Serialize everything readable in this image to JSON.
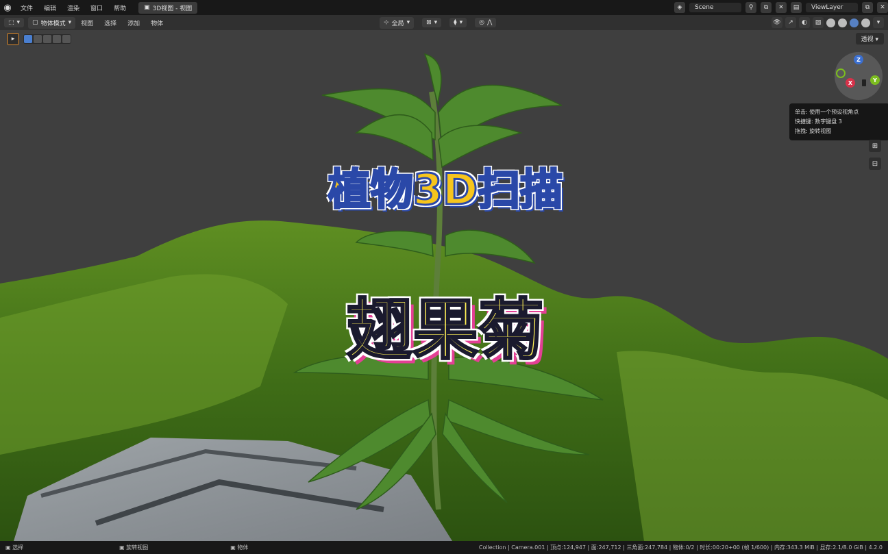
{
  "menubar": {
    "items": [
      "文件",
      "编辑",
      "渲染",
      "窗口",
      "帮助"
    ],
    "workspace_tab": "3D视图 - 视图",
    "scene_label": "Scene",
    "viewlayer_label": "ViewLayer"
  },
  "header": {
    "mode_label": "物体模式",
    "items": [
      "视图",
      "选择",
      "添加",
      "物体"
    ],
    "transform_orientation": "全局"
  },
  "viewport": {
    "opacity_button": "透视",
    "tooltip_lines": [
      "单击: 使用一个预设视角点",
      "快捷键: 数字键盘 3",
      "拖拽: 旋转视图"
    ],
    "gizmo_axes": {
      "x": "X",
      "y": "Y",
      "z": "Z"
    }
  },
  "overlay": {
    "title_line1": "植物3D扫描",
    "title_line2": "翅果菊"
  },
  "statusbar": {
    "left_items": [
      "选择",
      "旋转视图",
      "物体"
    ],
    "right_text": "Collection | Camera.001 | 顶点:124,947 | 面:247,712 | 三角面:247,784 | 物体:0/2 | 时长:00:20+00 (帧 1/600) | 内存:343.3 MiB | 显存:2.1/8.0 GiB | 4.2.0"
  },
  "colors": {
    "title1_fill": "#f7c51c",
    "title1_stroke": "#2a48a8",
    "title2_fill": "#fff056",
    "title2_shadow": "#e33f95",
    "active_accent": "#4a7fd0",
    "tool_select_border": "#e38f2f"
  }
}
